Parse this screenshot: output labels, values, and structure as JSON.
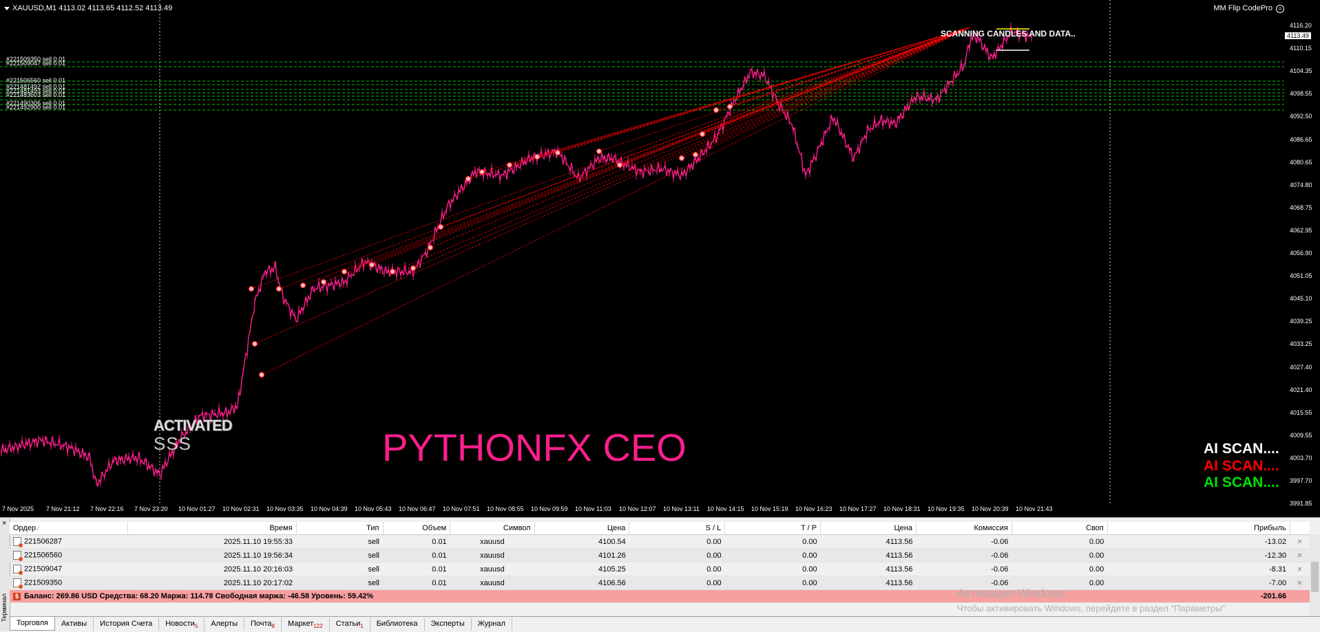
{
  "chart": {
    "caption": "XAUUSD,M1  4113.02 4113.65 4112.52 4113.49",
    "ea_label": "MM Flip CodePro",
    "scan_status": "SCANNING CANDLES AND DATA..",
    "activated": "ACTIVATED",
    "sss": "SSS",
    "brand": "PYTHONFX CEO",
    "ai_scan": [
      "AI SCAN....",
      "AI SCAN....",
      "AI SCAN...."
    ],
    "current_price": "4113.49",
    "price_ticks": [
      "4116.20",
      "4110.15",
      "4104.35",
      "4098.55",
      "4092.50",
      "4086.65",
      "4080.65",
      "4074.80",
      "4068.75",
      "4062.95",
      "4056.90",
      "4051.05",
      "4045.10",
      "4039.25",
      "4033.25",
      "4027.40",
      "4021.40",
      "4015.55",
      "4009.55",
      "4003.70",
      "3997.70",
      "3991.85"
    ],
    "time_ticks": [
      "7 Nov 2025",
      "7 Nov 21:12",
      "7 Nov 22:16",
      "7 Nov 23:20",
      "10 Nov 01:27",
      "10 Nov 02:31",
      "10 Nov 03:35",
      "10 Nov 04:39",
      "10 Nov 05:43",
      "10 Nov 06:47",
      "10 Nov 07:51",
      "10 Nov 08:55",
      "10 Nov 09:59",
      "10 Nov 11:03",
      "10 Nov 12:07",
      "10 Nov 13:11",
      "10 Nov 14:15",
      "10 Nov 15:19",
      "10 Nov 16:23",
      "10 Nov 17:27",
      "10 Nov 18:31",
      "10 Nov 19:35",
      "10 Nov 20:39",
      "10 Nov 21:43"
    ],
    "order_tags": [
      "#221509350 sell 0.01",
      "#221509047 sell 0.01",
      "#221506560 sell 0.01",
      "#221481492 sell 0.01",
      "#221481493 sell 0.01",
      "#221483603 sell 0.01",
      "#221490306 sell 0.01",
      "#221492900 sell 0.01"
    ],
    "colors": {
      "background": "#000000",
      "candles": "#ff1e8c",
      "hlines": "#00c000",
      "trade_lines": "#ff0000",
      "brand": "#ff1e8c"
    }
  },
  "terminal": {
    "vertical_label": "Терминал",
    "columns": [
      "Ордер",
      "Время",
      "Тип",
      "Объем",
      "Символ",
      "Цена",
      "S / L",
      "T / P",
      "Цена",
      "Комиссия",
      "Своп",
      "Прибыль"
    ],
    "rows": [
      [
        "221506287",
        "2025.11.10 19:55:33",
        "sell",
        "0.01",
        "xauusd",
        "4100.54",
        "0.00",
        "0.00",
        "4113.56",
        "-0.06",
        "0.00",
        "-13.02"
      ],
      [
        "221506560",
        "2025.11.10 19:56:34",
        "sell",
        "0.01",
        "xauusd",
        "4101.26",
        "0.00",
        "0.00",
        "4113.56",
        "-0.06",
        "0.00",
        "-12.30"
      ],
      [
        "221509047",
        "2025.11.10 20:16:03",
        "sell",
        "0.01",
        "xauusd",
        "4105.25",
        "0.00",
        "0.00",
        "4113.56",
        "-0.06",
        "0.00",
        "-8.31"
      ],
      [
        "221509350",
        "2025.11.10 20:17:02",
        "sell",
        "0.01",
        "xauusd",
        "4106.56",
        "0.00",
        "0.00",
        "4113.56",
        "-0.06",
        "0.00",
        "-7.00"
      ]
    ],
    "balance_line": "Баланс: 269.86 USD  Средства: 68.20  Маржа: 114.78  Свободная маржа: -46.58  Уровень: 59.42%",
    "balance_profit": "-201.66",
    "watermark_title": "Активация Windows",
    "watermark_text": "Чтобы активировать Windows, перейдите в раздел \"Параметры\".",
    "tabs": [
      {
        "label": "Торговля",
        "badge": ""
      },
      {
        "label": "Активы",
        "badge": ""
      },
      {
        "label": "История Счета",
        "badge": ""
      },
      {
        "label": "Новости",
        "badge": "5"
      },
      {
        "label": "Алерты",
        "badge": ""
      },
      {
        "label": "Почта",
        "badge": "8"
      },
      {
        "label": "Маркет",
        "badge": "122"
      },
      {
        "label": "Статьи",
        "badge": "1"
      },
      {
        "label": "Библиотека",
        "badge": ""
      },
      {
        "label": "Эксперты",
        "badge": ""
      },
      {
        "label": "Журнал",
        "badge": ""
      }
    ]
  }
}
